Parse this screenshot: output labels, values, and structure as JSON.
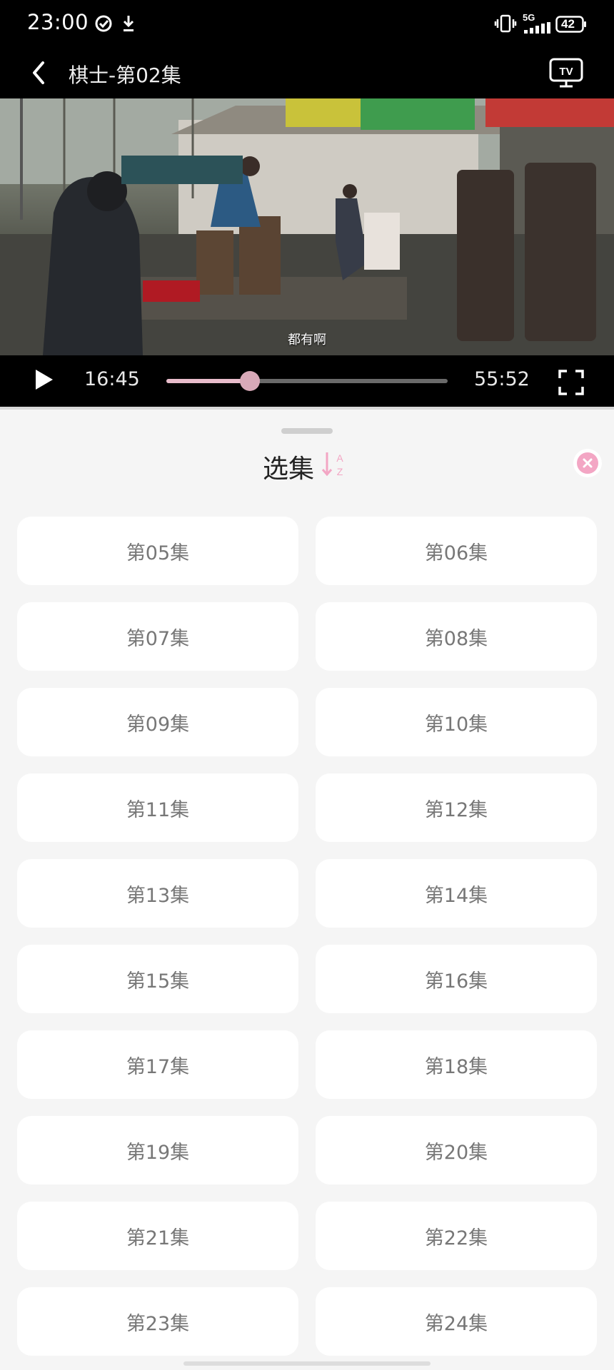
{
  "status_bar": {
    "time": "23:00",
    "network": "5G",
    "battery": "42"
  },
  "header": {
    "title": "棋士-第02集",
    "tv_label": "TV"
  },
  "video": {
    "subtitle": "都有啊"
  },
  "player": {
    "current_time": "16:45",
    "total_time": "55:52",
    "progress": 0.2965
  },
  "sheet": {
    "title": "选集",
    "sort_letters": [
      "A",
      "Z"
    ],
    "accent_color": "#f3a6c4"
  },
  "episodes": [
    "第05集",
    "第06集",
    "第07集",
    "第08集",
    "第09集",
    "第10集",
    "第11集",
    "第12集",
    "第13集",
    "第14集",
    "第15集",
    "第16集",
    "第17集",
    "第18集",
    "第19集",
    "第20集",
    "第21集",
    "第22集",
    "第23集",
    "第24集"
  ]
}
